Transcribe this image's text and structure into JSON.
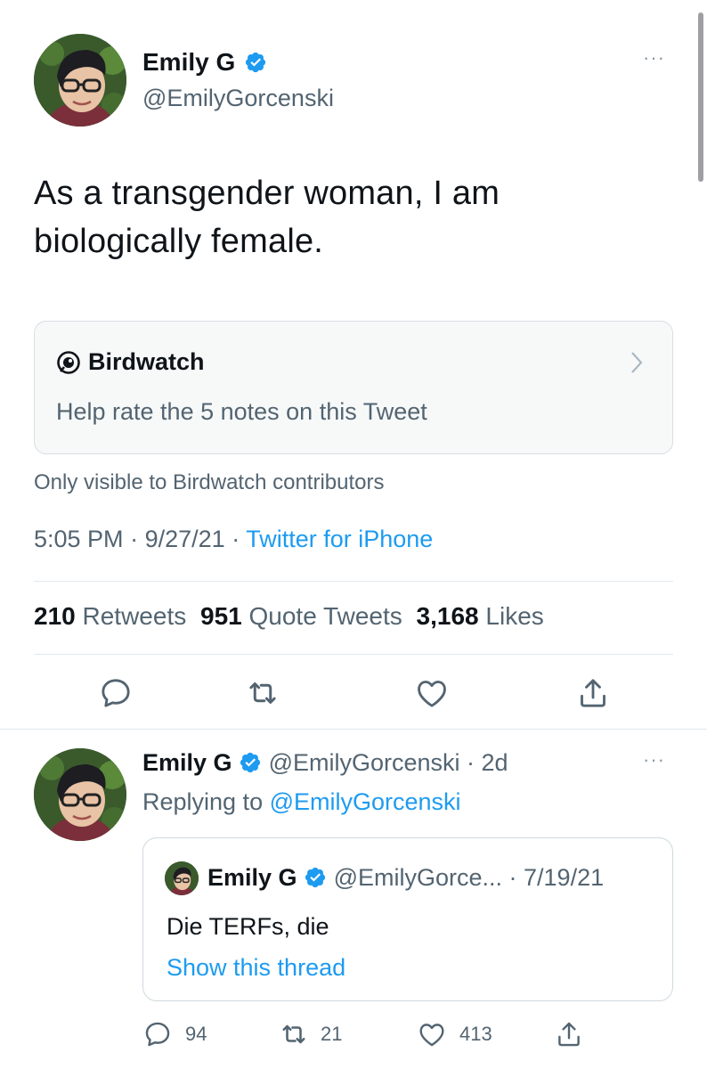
{
  "main_tweet": {
    "author_name": "Emily G",
    "author_handle": "@EmilyGorcenski",
    "text_line1": "As a transgender woman, I am",
    "text_line2": "biologically female.",
    "birdwatch": {
      "title": "Birdwatch",
      "prompt": "Help rate the 5 notes on this Tweet",
      "visibility_note": "Only visible to Birdwatch contributors"
    },
    "time": "5:05 PM",
    "date": "9/27/21",
    "source": "Twitter for iPhone",
    "stats": {
      "retweets_count": "210",
      "retweets_label": "Retweets",
      "quotes_count": "951",
      "quotes_label": "Quote Tweets",
      "likes_count": "3,168",
      "likes_label": "Likes"
    }
  },
  "reply_tweet": {
    "author_name": "Emily G",
    "author_handle": "@EmilyGorcenski",
    "age": "· 2d",
    "replying_prefix": "Replying to",
    "replying_to": "@EmilyGorcenski",
    "quoted": {
      "author_name": "Emily G",
      "author_handle": "@EmilyGorce...",
      "date": "· 7/19/21",
      "text": "Die TERFs, die",
      "show_thread": "Show this thread"
    },
    "counts": {
      "replies": "94",
      "retweets": "21",
      "likes": "413"
    }
  },
  "colors": {
    "accent": "#1d9bf0",
    "muted_text": "#536471",
    "divider": "#e1e8ed"
  },
  "icons": [
    "verified-badge-icon",
    "more-options-icon",
    "birdwatch-icon",
    "chevron-right-icon",
    "reply-icon",
    "retweet-icon",
    "like-icon",
    "share-icon"
  ]
}
